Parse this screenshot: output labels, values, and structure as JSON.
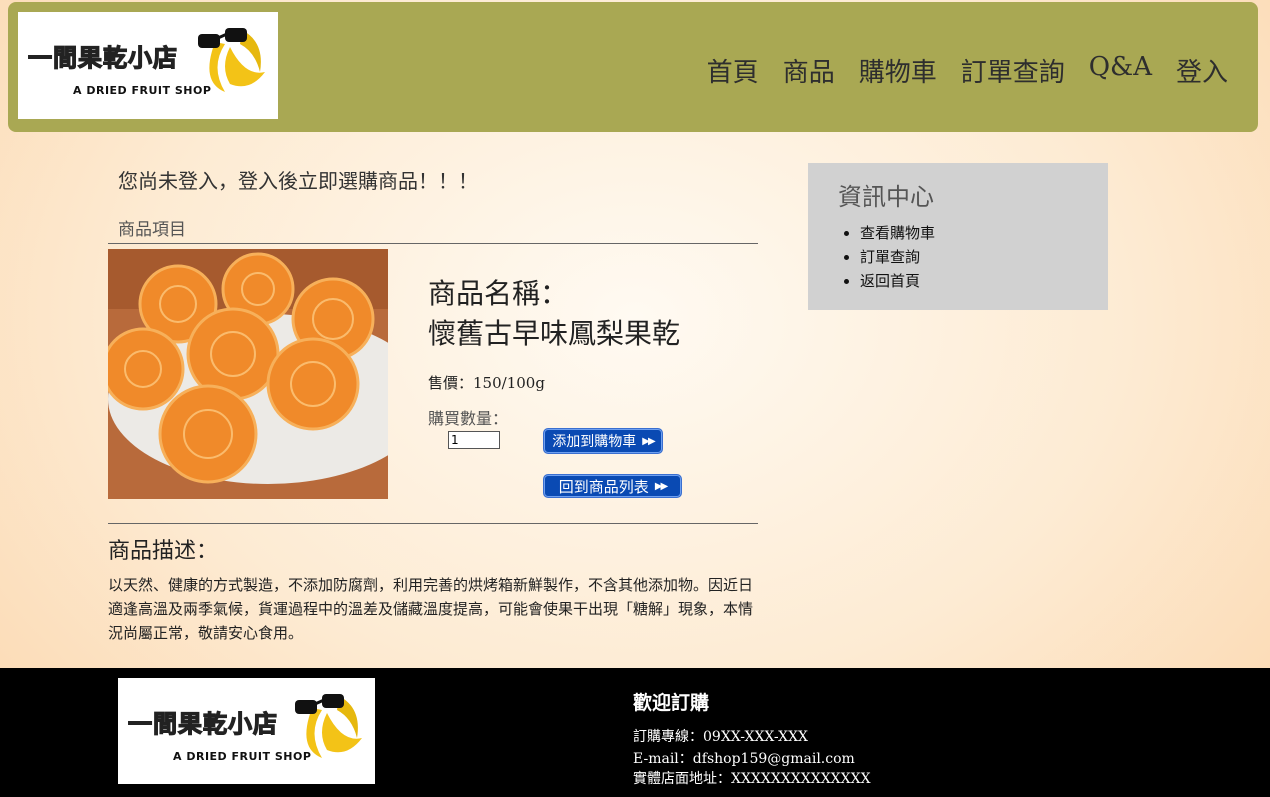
{
  "header": {
    "logo": {
      "title": "一間果乾小店",
      "subtitle": "A DRIED FRUIT SHOP"
    },
    "nav": [
      "首頁",
      "商品",
      "購物車",
      "訂單查詢",
      "Q&A",
      "登入"
    ]
  },
  "main": {
    "login_message": "您尚未登入，登入後立即選購商品！！！",
    "section_label": "商品項目",
    "product": {
      "name_label": "商品名稱：",
      "name": "懷舊古早味鳳梨果乾",
      "price_label": "售價：",
      "price": "150/100g",
      "qty_label": "購買數量：",
      "qty_value": "1",
      "add_button": "添加到購物車",
      "back_button": "回到商品列表"
    },
    "description_title": "商品描述：",
    "description": "以天然、健康的方式製造，不添加防腐劑，利用完善的烘烤箱新鮮製作，不含其他添加物。因近日適逢高溫及兩季氣候，貨運過程中的溫差及儲藏溫度提高，可能會使果干出現「糖解」現象，本情況尚屬正常，敬請安心食用。"
  },
  "info_panel": {
    "title": "資訊中心",
    "links": [
      "查看購物車",
      "訂單查詢",
      "返回首頁"
    ]
  },
  "footer": {
    "title": "歡迎訂購",
    "phone_label": "訂購專線：",
    "phone": "09XX-XXX-XXX",
    "email_label": "E-mail：",
    "email": "dfshop159@gmail.com",
    "address_label": "實體店面地址：",
    "address": "XXXXXXXXXXXXXX"
  },
  "colors": {
    "header_bg": "#a9a853",
    "button_bg": "#0a4ab3",
    "info_bg": "#d1d1d1",
    "footer_bg": "#000000"
  }
}
